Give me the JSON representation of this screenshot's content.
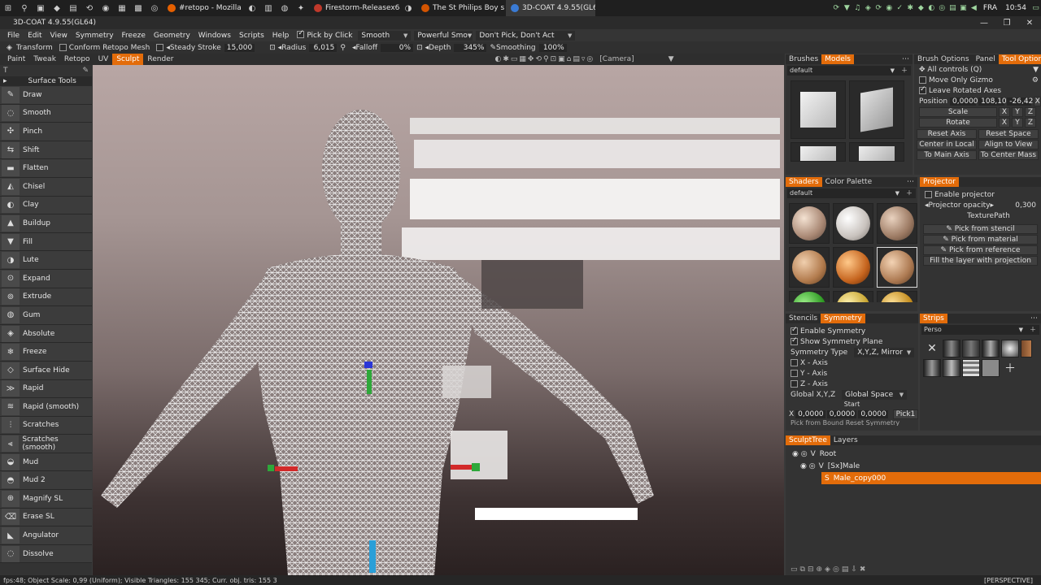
{
  "taskbar": {
    "tasks": [
      {
        "label": "#retopo - Mozilla Fire...",
        "color": "#e66000"
      },
      {
        "label": "Firestorm-Releasex64 ...",
        "color": "#c0392b"
      },
      {
        "label": "The St Philips Boy s C...",
        "color": "#d35400"
      },
      {
        "label": "3D-COAT 4.9.55(GL64)",
        "color": "#3a7bd5"
      }
    ],
    "language": "FRA",
    "clock": "10:54"
  },
  "window": {
    "title": "3D-COAT 4.9.55(GL64)"
  },
  "menu": {
    "items": [
      "File",
      "Edit",
      "View",
      "Symmetry",
      "Freeze",
      "Geometry",
      "Windows",
      "Scripts",
      "Help"
    ],
    "pick_by_click": "Pick by Click",
    "smooth_mode": "Smooth",
    "powerful_smooth": "Powerful Smo",
    "dont_pick": "Don't Pick, Don't Act"
  },
  "options": {
    "transform": "Transform",
    "conform_retopo_mesh": "Conform Retopo Mesh",
    "steady_stroke": "Steady Stroke",
    "steady_value": "15,000",
    "radius_label": "Radius",
    "radius_value": "6,015",
    "falloff_label": "Falloff",
    "falloff_value": "0%",
    "depth_label": "Depth",
    "depth_value": "345%",
    "smoothing_label": "Smoothing",
    "smoothing_value": "100%"
  },
  "modes": {
    "tabs": [
      "Paint",
      "Tweak",
      "Retopo",
      "UV",
      "Sculpt",
      "Render"
    ],
    "active": "Sculpt",
    "camera": "[Camera]"
  },
  "left_panel": {
    "title": "Surface Tools",
    "tools": [
      "Draw",
      "Smooth",
      "Pinch",
      "Shift",
      "Flatten",
      "Chisel",
      "Clay",
      "Buildup",
      "Fill",
      "Lute",
      "Expand",
      "Extrude",
      "Gum",
      "Absolute",
      "Freeze",
      "Surface Hide",
      "Rapid",
      "Rapid (smooth)",
      "Scratches",
      "Scratches (smooth)",
      "Mud",
      "Mud 2",
      "Magnify SL",
      "Erase SL",
      "Angulator",
      "Dissolve"
    ]
  },
  "brushes_panel": {
    "tabs": [
      "Brushes",
      "Models"
    ],
    "active": "Models",
    "preset": "default"
  },
  "tool_options_panel": {
    "tabs": [
      "Brush Options",
      "Panel",
      "Tool Options"
    ],
    "active": "Tool Options",
    "all_controls": "All controls (Q)",
    "move_only_gizmo": "Move Only Gizmo",
    "leave_rotated_axes": "Leave Rotated Axes",
    "position_label": "Position",
    "position": [
      "0,0000",
      "108,10",
      "-26,42"
    ],
    "scale_label": "Scale",
    "rotate_label": "Rotate",
    "axis_letters": [
      "X",
      "Y",
      "Z"
    ],
    "buttons": [
      "Reset Axis",
      "Reset Space",
      "Center in Local",
      "Align to View",
      "To Main Axis",
      "To Center Mass"
    ]
  },
  "shaders_panel": {
    "tabs": [
      "Shaders",
      "Color Palette"
    ],
    "active": "Shaders",
    "preset": "default"
  },
  "projector_panel": {
    "tab": "Projector",
    "enable": "Enable projector",
    "opacity_label": "Projector opacity",
    "opacity_value": "0,300",
    "texture_path": "TexturePath",
    "buttons": [
      "Pick from stencil",
      "Pick from material",
      "Pick from reference"
    ],
    "fill_layer": "Fill the layer with projection"
  },
  "symmetry_panel": {
    "tabs": [
      "Stencils",
      "Symmetry"
    ],
    "active": "Symmetry",
    "enable_symmetry": "Enable Symmetry",
    "show_plane": "Show Symmetry Plane",
    "type_label": "Symmetry Type",
    "type_value": "X,Y,Z, Mirror",
    "axes": [
      "X - Axis",
      "Y - Axis",
      "Z - Axis"
    ],
    "global_label": "Global X,Y,Z",
    "global_value": "Global Space",
    "start_label": "Start",
    "start_values": [
      "0,0000",
      "0,0000",
      "0,0000"
    ],
    "pick_button": "Pick1",
    "cut_row": "Pick from Bound    Reset Symmetry"
  },
  "strips_panel": {
    "tab": "Strips",
    "preset": "Perso"
  },
  "sculpt_tree": {
    "tabs": [
      "SculptTree",
      "Layers"
    ],
    "active": "SculptTree",
    "nodes": [
      {
        "label": "Root",
        "flag": "V"
      },
      {
        "label": "[Sx]Male",
        "flag": "V"
      },
      {
        "label": "Male_copy000",
        "flag": "S",
        "selected": true
      }
    ]
  },
  "status": {
    "text": "fps:48;   Object Scale: 0,99 (Uniform); Visible Triangles: 155 345; Curr. obj. tris: 155 3",
    "view": "[PERSPECTIVE]"
  },
  "colors": {
    "accent": "#e36c0a"
  }
}
